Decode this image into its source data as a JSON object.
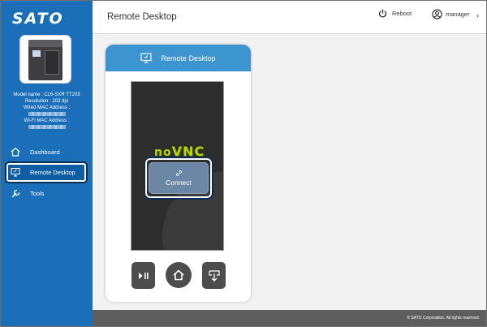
{
  "brand": {
    "logo_text": "SATO"
  },
  "printer": {
    "model": "Model name : CL6-SXR TT203",
    "resolution": "Resolution : 203 dpi",
    "wired_mac_label": "Wired MAC Address :",
    "wifi_mac_label": "Wi-Fi MAC Address :"
  },
  "sidebar": {
    "items": [
      {
        "label": "Dashboard",
        "icon": "home-icon",
        "active": false
      },
      {
        "label": "Remote Desktop",
        "icon": "monitor-icon",
        "active": true
      },
      {
        "label": "Tools",
        "icon": "wrench-icon",
        "active": false
      }
    ]
  },
  "header": {
    "title": "Remote Desktop",
    "reboot_label": "Reboot",
    "user_label": "manager",
    "chevron": "›"
  },
  "card": {
    "title": "Remote Desktop",
    "novnc_no": "no",
    "novnc_vnc": "VNC",
    "connect_label": "Connect",
    "controls": [
      {
        "name": "play-pause-icon",
        "glyph": "▶❙"
      },
      {
        "name": "home-icon",
        "glyph": ""
      },
      {
        "name": "download-icon",
        "glyph": ""
      }
    ]
  },
  "footer": {
    "copyright": "© SATO Corporation. All rights reserved."
  },
  "colors": {
    "sidebar": "#1a6fb8",
    "card_header": "#3c95cf",
    "connect_button": "#6c86a5",
    "footer": "#5e5e5e",
    "novnc": "#b6d900"
  }
}
